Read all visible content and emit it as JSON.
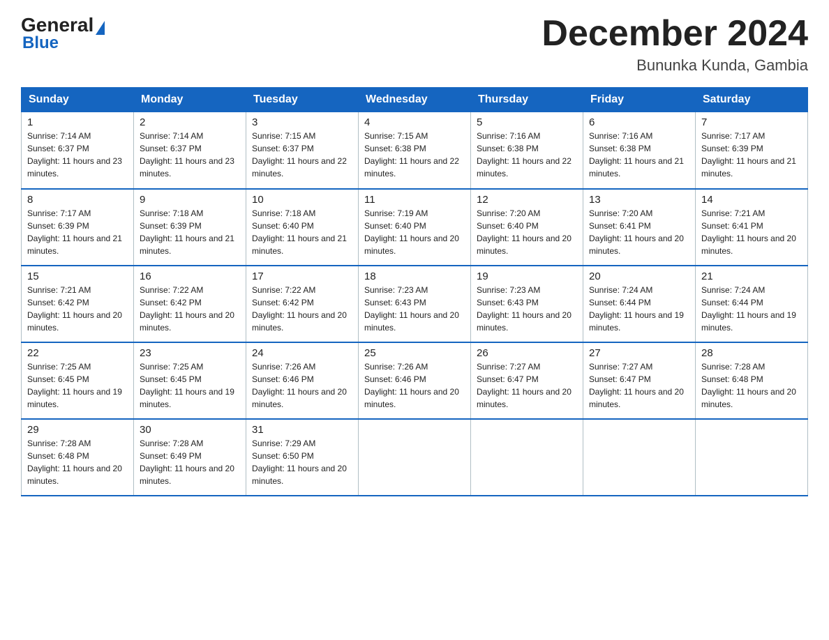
{
  "header": {
    "logo_general": "General",
    "logo_blue": "Blue",
    "month_title": "December 2024",
    "location": "Bununka Kunda, Gambia"
  },
  "days_of_week": [
    "Sunday",
    "Monday",
    "Tuesday",
    "Wednesday",
    "Thursday",
    "Friday",
    "Saturday"
  ],
  "weeks": [
    [
      {
        "day": "1",
        "sunrise": "7:14 AM",
        "sunset": "6:37 PM",
        "daylight": "11 hours and 23 minutes."
      },
      {
        "day": "2",
        "sunrise": "7:14 AM",
        "sunset": "6:37 PM",
        "daylight": "11 hours and 23 minutes."
      },
      {
        "day": "3",
        "sunrise": "7:15 AM",
        "sunset": "6:37 PM",
        "daylight": "11 hours and 22 minutes."
      },
      {
        "day": "4",
        "sunrise": "7:15 AM",
        "sunset": "6:38 PM",
        "daylight": "11 hours and 22 minutes."
      },
      {
        "day": "5",
        "sunrise": "7:16 AM",
        "sunset": "6:38 PM",
        "daylight": "11 hours and 22 minutes."
      },
      {
        "day": "6",
        "sunrise": "7:16 AM",
        "sunset": "6:38 PM",
        "daylight": "11 hours and 21 minutes."
      },
      {
        "day": "7",
        "sunrise": "7:17 AM",
        "sunset": "6:39 PM",
        "daylight": "11 hours and 21 minutes."
      }
    ],
    [
      {
        "day": "8",
        "sunrise": "7:17 AM",
        "sunset": "6:39 PM",
        "daylight": "11 hours and 21 minutes."
      },
      {
        "day": "9",
        "sunrise": "7:18 AM",
        "sunset": "6:39 PM",
        "daylight": "11 hours and 21 minutes."
      },
      {
        "day": "10",
        "sunrise": "7:18 AM",
        "sunset": "6:40 PM",
        "daylight": "11 hours and 21 minutes."
      },
      {
        "day": "11",
        "sunrise": "7:19 AM",
        "sunset": "6:40 PM",
        "daylight": "11 hours and 20 minutes."
      },
      {
        "day": "12",
        "sunrise": "7:20 AM",
        "sunset": "6:40 PM",
        "daylight": "11 hours and 20 minutes."
      },
      {
        "day": "13",
        "sunrise": "7:20 AM",
        "sunset": "6:41 PM",
        "daylight": "11 hours and 20 minutes."
      },
      {
        "day": "14",
        "sunrise": "7:21 AM",
        "sunset": "6:41 PM",
        "daylight": "11 hours and 20 minutes."
      }
    ],
    [
      {
        "day": "15",
        "sunrise": "7:21 AM",
        "sunset": "6:42 PM",
        "daylight": "11 hours and 20 minutes."
      },
      {
        "day": "16",
        "sunrise": "7:22 AM",
        "sunset": "6:42 PM",
        "daylight": "11 hours and 20 minutes."
      },
      {
        "day": "17",
        "sunrise": "7:22 AM",
        "sunset": "6:42 PM",
        "daylight": "11 hours and 20 minutes."
      },
      {
        "day": "18",
        "sunrise": "7:23 AM",
        "sunset": "6:43 PM",
        "daylight": "11 hours and 20 minutes."
      },
      {
        "day": "19",
        "sunrise": "7:23 AM",
        "sunset": "6:43 PM",
        "daylight": "11 hours and 20 minutes."
      },
      {
        "day": "20",
        "sunrise": "7:24 AM",
        "sunset": "6:44 PM",
        "daylight": "11 hours and 19 minutes."
      },
      {
        "day": "21",
        "sunrise": "7:24 AM",
        "sunset": "6:44 PM",
        "daylight": "11 hours and 19 minutes."
      }
    ],
    [
      {
        "day": "22",
        "sunrise": "7:25 AM",
        "sunset": "6:45 PM",
        "daylight": "11 hours and 19 minutes."
      },
      {
        "day": "23",
        "sunrise": "7:25 AM",
        "sunset": "6:45 PM",
        "daylight": "11 hours and 19 minutes."
      },
      {
        "day": "24",
        "sunrise": "7:26 AM",
        "sunset": "6:46 PM",
        "daylight": "11 hours and 20 minutes."
      },
      {
        "day": "25",
        "sunrise": "7:26 AM",
        "sunset": "6:46 PM",
        "daylight": "11 hours and 20 minutes."
      },
      {
        "day": "26",
        "sunrise": "7:27 AM",
        "sunset": "6:47 PM",
        "daylight": "11 hours and 20 minutes."
      },
      {
        "day": "27",
        "sunrise": "7:27 AM",
        "sunset": "6:47 PM",
        "daylight": "11 hours and 20 minutes."
      },
      {
        "day": "28",
        "sunrise": "7:28 AM",
        "sunset": "6:48 PM",
        "daylight": "11 hours and 20 minutes."
      }
    ],
    [
      {
        "day": "29",
        "sunrise": "7:28 AM",
        "sunset": "6:48 PM",
        "daylight": "11 hours and 20 minutes."
      },
      {
        "day": "30",
        "sunrise": "7:28 AM",
        "sunset": "6:49 PM",
        "daylight": "11 hours and 20 minutes."
      },
      {
        "day": "31",
        "sunrise": "7:29 AM",
        "sunset": "6:50 PM",
        "daylight": "11 hours and 20 minutes."
      },
      null,
      null,
      null,
      null
    ]
  ],
  "labels": {
    "sunrise": "Sunrise: ",
    "sunset": "Sunset: ",
    "daylight": "Daylight: "
  }
}
